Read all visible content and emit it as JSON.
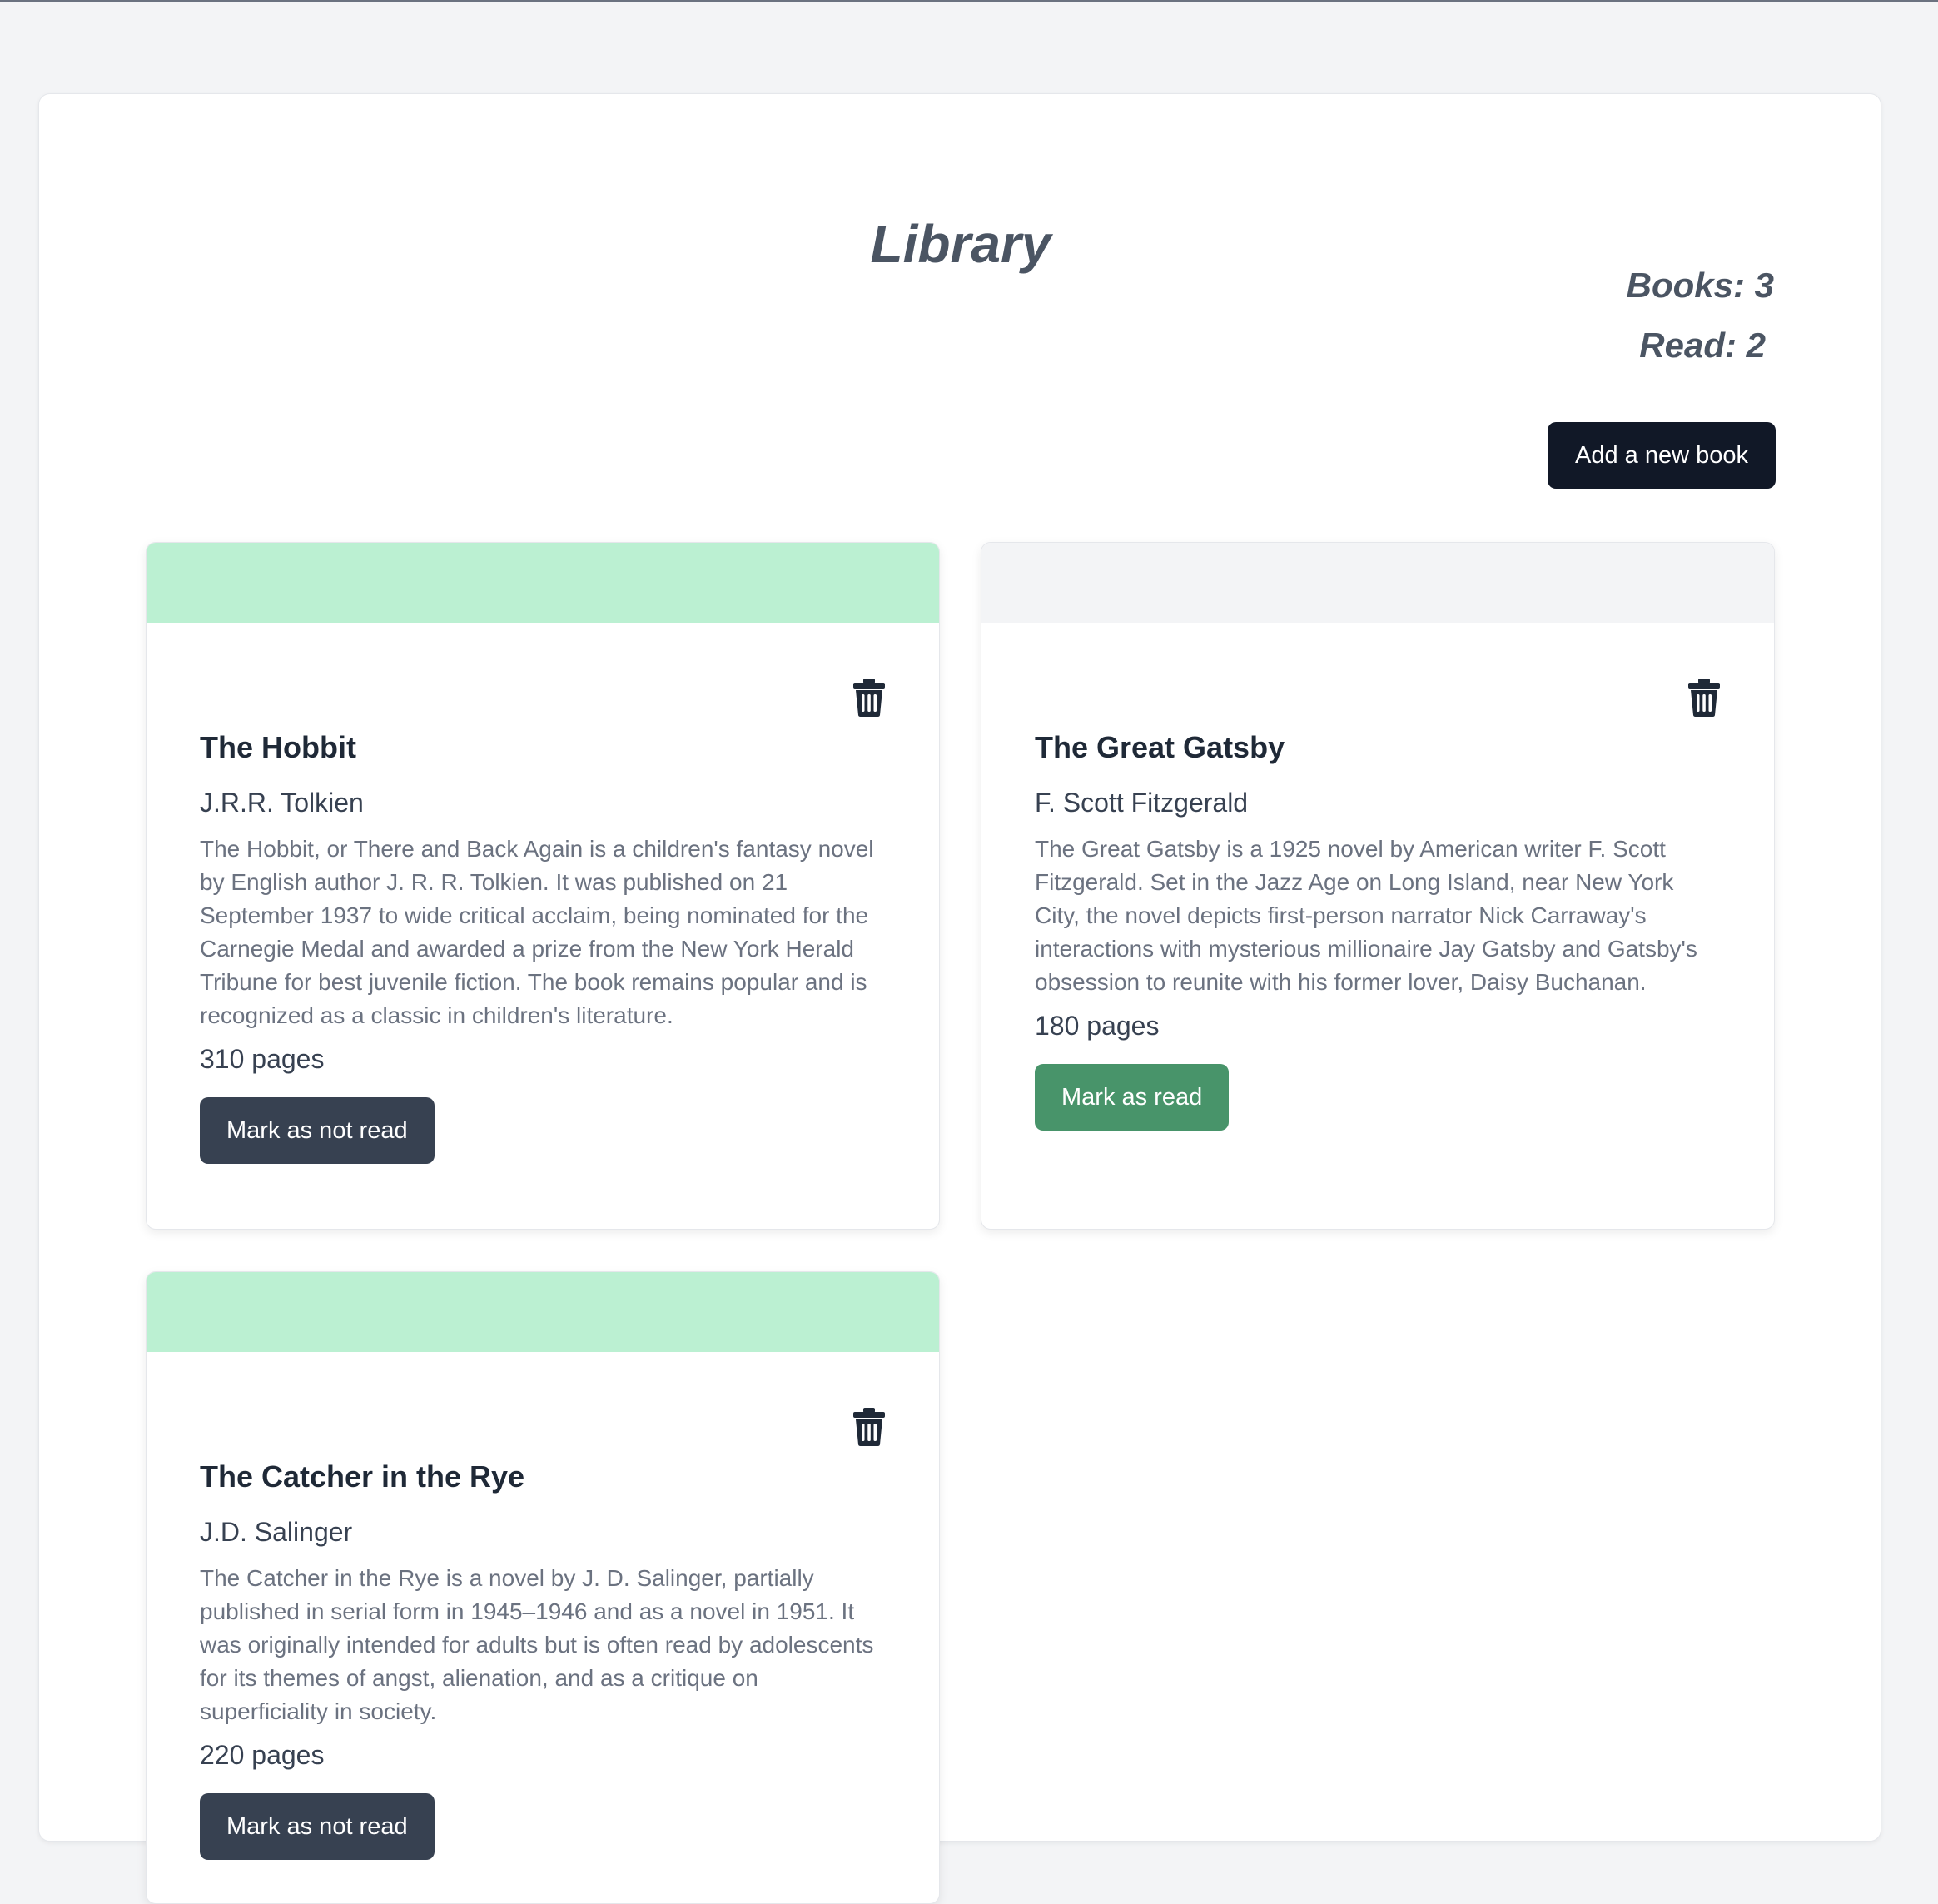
{
  "app": {
    "title": "Library",
    "stats": {
      "books_label": "Books: 3",
      "read_label": "Read: 2"
    },
    "add_button_label": "Add a new book"
  },
  "colors": {
    "read_banner": "#bbf0d2",
    "unread_banner": "#f3f4f6",
    "mark_not_read_button": "#374151",
    "mark_read_button": "#48946a",
    "add_button": "#111827"
  },
  "books": [
    {
      "title": "The Hobbit",
      "author": "J.R.R. Tolkien",
      "description": "The Hobbit, or There and Back Again is a children's fantasy novel by English author J. R. R. Tolkien. It was published on 21 September 1937 to wide critical acclaim, being nominated for the Carnegie Medal and awarded a prize from the New York Herald Tribune for best juvenile fiction. The book remains popular and is recognized as a classic in children's literature.",
      "pages": "310 pages",
      "read": true,
      "button_label": "Mark as not read",
      "delete_icon": "trash-icon"
    },
    {
      "title": "The Great Gatsby",
      "author": "F. Scott Fitzgerald",
      "description": "The Great Gatsby is a 1925 novel by American writer F. Scott Fitzgerald. Set in the Jazz Age on Long Island, near New York City, the novel depicts first-person narrator Nick Carraway's interactions with mysterious millionaire Jay Gatsby and Gatsby's obsession to reunite with his former lover, Daisy Buchanan.",
      "pages": "180 pages",
      "read": false,
      "button_label": "Mark as read",
      "delete_icon": "trash-icon"
    },
    {
      "title": "The Catcher in the Rye",
      "author": "J.D. Salinger",
      "description": "The Catcher in the Rye is a novel by J. D. Salinger, partially published in serial form in 1945–1946 and as a novel in 1951. It was originally intended for adults but is often read by adolescents for its themes of angst, alienation, and as a critique on superficiality in society.",
      "pages": "220 pages",
      "read": true,
      "button_label": "Mark as not read",
      "delete_icon": "trash-icon"
    }
  ]
}
